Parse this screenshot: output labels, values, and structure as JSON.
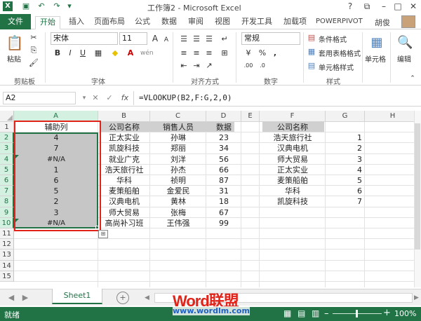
{
  "window": {
    "title": "工作簿2 - Microsoft Excel",
    "controls": [
      "?",
      "⧉",
      "–",
      "□",
      "✕"
    ]
  },
  "tabs": [
    "文件",
    "开始",
    "插入",
    "页面布局",
    "公式",
    "数据",
    "审阅",
    "视图",
    "开发工具",
    "加载项",
    "POWERPIVOT"
  ],
  "user": "胡俊",
  "ribbon": {
    "clipboard": {
      "paste": "粘贴",
      "label": "剪贴板"
    },
    "font": {
      "name": "宋体",
      "size": "11",
      "label": "字体"
    },
    "alignment": {
      "label": "对齐方式"
    },
    "number": {
      "format": "常规",
      "label": "数字",
      "percent": "%",
      "comma": ","
    },
    "styles": {
      "conditional": "条件格式",
      "table": "套用表格格式",
      "cell_styles": "单元格样式",
      "label": "样式"
    },
    "cells": {
      "label": "单元格"
    },
    "editing": {
      "label": "编辑"
    }
  },
  "formula_bar": {
    "name_box": "A2",
    "fx": "fx",
    "formula": "=VLOOKUP(B2,F:G,2,0)"
  },
  "columns": [
    "A",
    "B",
    "C",
    "D",
    "E",
    "F",
    "G",
    "H"
  ],
  "rows": [
    "1",
    "2",
    "3",
    "4",
    "5",
    "6",
    "7",
    "8",
    "9",
    "10",
    "11",
    "12",
    "13",
    "14",
    "15"
  ],
  "colA": [
    "辅助列",
    "4",
    "7",
    "#N/A",
    "1",
    "6",
    "5",
    "2",
    "3",
    "#N/A"
  ],
  "colB": [
    "公司名称",
    "正太实业",
    "凯旋科技",
    "就业广克",
    "浩天旅行社",
    "华科",
    "麦策船舶",
    "汉典电机",
    "师大贸易",
    "高尚补习班"
  ],
  "colC": [
    "销售人员",
    "孙琳",
    "郑丽",
    "刘洋",
    "孙杰",
    "祯明",
    "金爱民",
    "黄林",
    "张梅",
    "王伟强"
  ],
  "colD": [
    "数据",
    "23",
    "34",
    "56",
    "66",
    "87",
    "31",
    "18",
    "67",
    "99"
  ],
  "colF": [
    "公司名称",
    "浩天旅行社",
    "汉典电机",
    "师大贸易",
    "正太实业",
    "麦策船舶",
    "华科",
    "凯旋科技"
  ],
  "colG": [
    "",
    "1",
    "2",
    "3",
    "4",
    "5",
    "6",
    "7"
  ],
  "sheet_tab": "Sheet1",
  "status": {
    "ready": "就绪",
    "zoom": "100%"
  },
  "watermark": {
    "brand": "Word联盟",
    "url": "www.wordlm.com"
  }
}
